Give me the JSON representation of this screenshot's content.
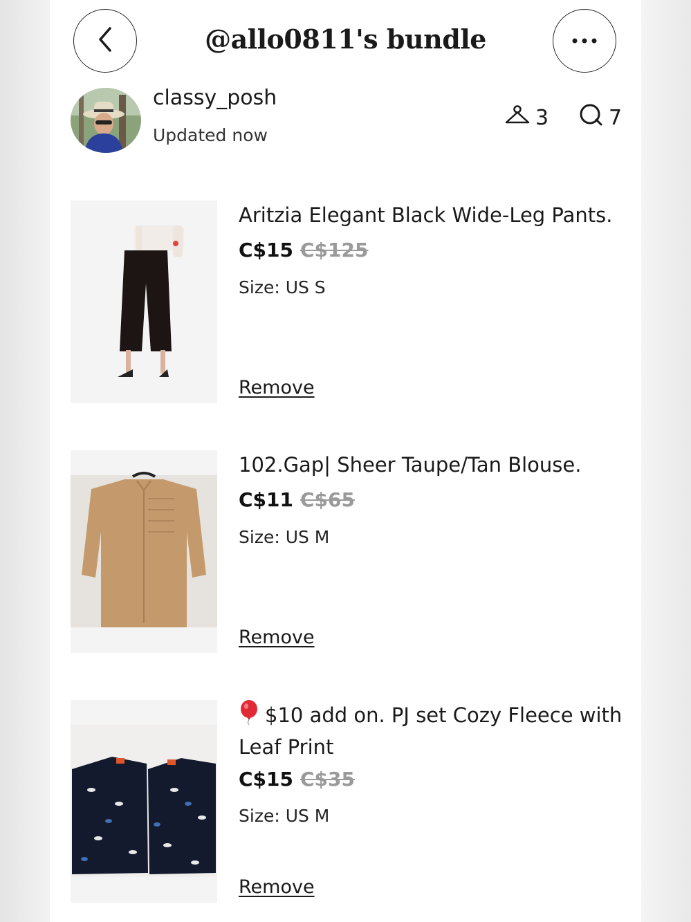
{
  "header": {
    "title": "@allo0811's bundle",
    "back_icon": "chevron-left-icon",
    "more_icon": "more-horizontal-icon"
  },
  "seller": {
    "username": "classy_posh",
    "updated": "Updated now",
    "likes_count": "3",
    "comments_count": "7",
    "likes_icon": "hanger-icon",
    "comments_icon": "comment-bubble-icon"
  },
  "items": [
    {
      "title": "Aritzia Elegant Black Wide-Leg Pants.",
      "price": "C$15",
      "original_price": "C$125",
      "size": "Size: US S",
      "remove_label": "Remove"
    },
    {
      "title": "102.Gap| Sheer Taupe/Tan Blouse.",
      "price": "C$11",
      "original_price": "C$65",
      "size": "Size: US M",
      "remove_label": "Remove"
    },
    {
      "title_icon": "balloon-icon",
      "title": "$10 add on. PJ set Cozy Fleece with Leaf Print",
      "price": "C$15",
      "original_price": "C$35",
      "size": "Size: US M",
      "remove_label": "Remove"
    }
  ],
  "colors": {
    "text": "#1a1a1a",
    "strike_price": "#9a9a9a",
    "pants": "#1c1513",
    "blouse": "#c49a6c",
    "pj": "#141a2e"
  }
}
